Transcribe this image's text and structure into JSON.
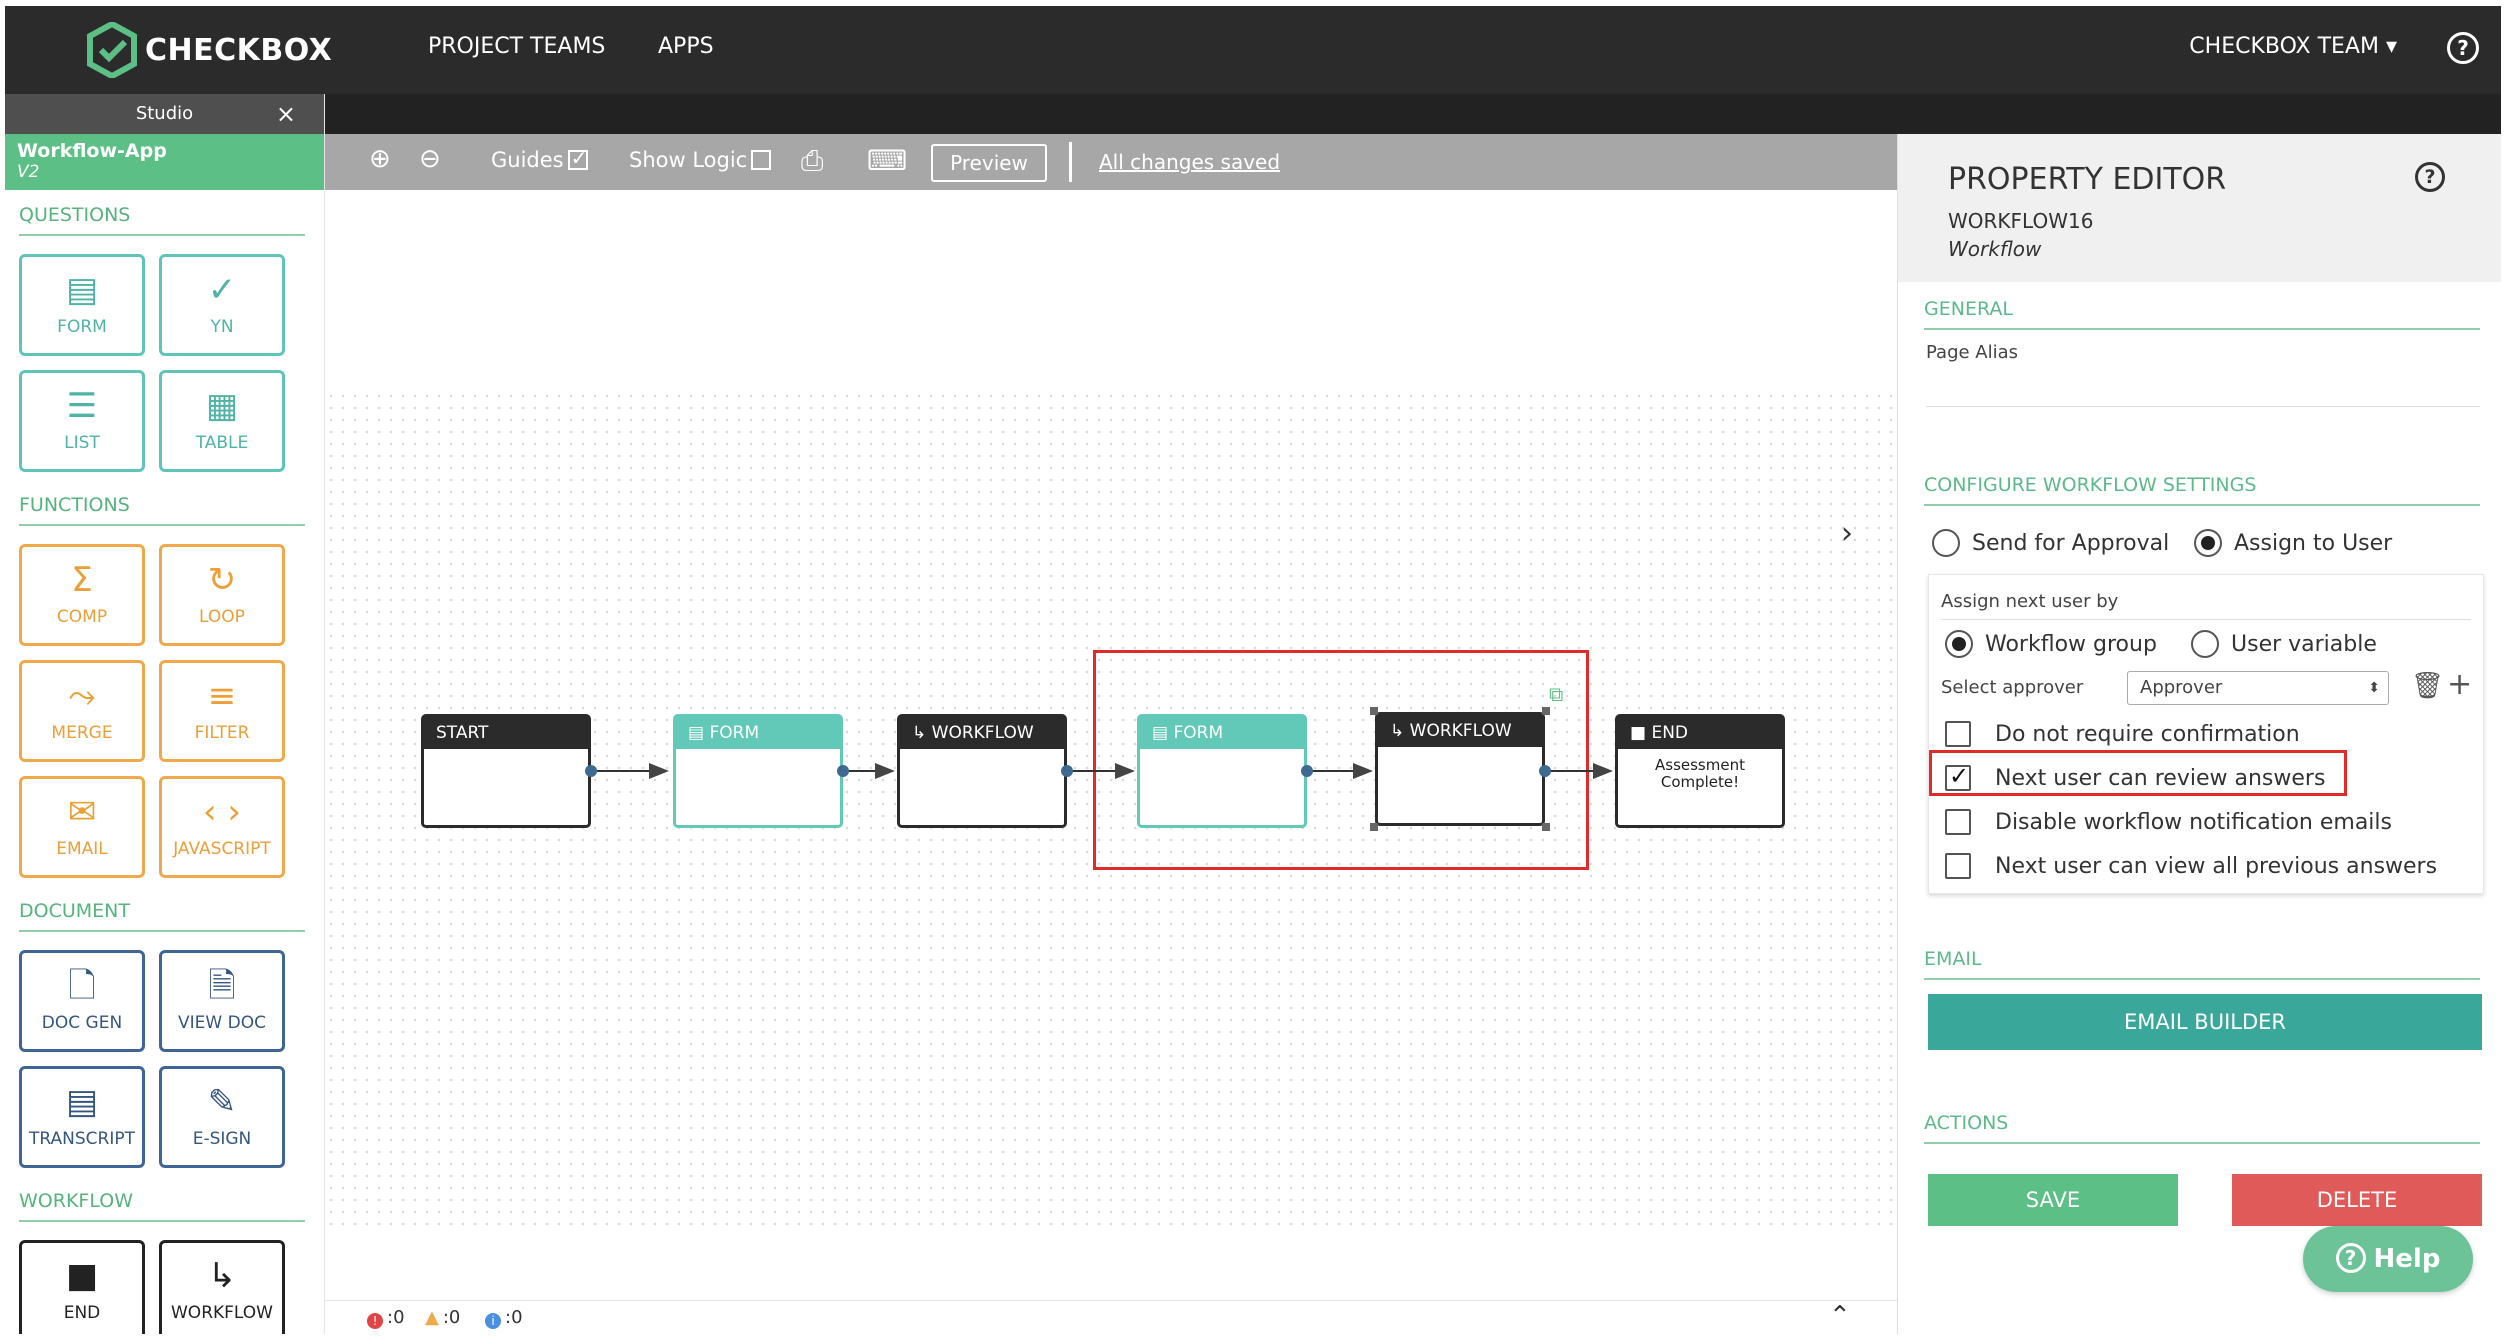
{
  "brand": {
    "name": "CHECKBOX",
    "accent": "#5cbf85"
  },
  "nav": {
    "project_teams": "PROJECT TEAMS",
    "apps": "APPS",
    "team": "CHECKBOX TEAM",
    "help": "?"
  },
  "sidebar": {
    "tab_label": "Studio",
    "close": "×",
    "app_name": "Workflow-App",
    "app_version": "V2",
    "sections": {
      "questions": "QUESTIONS",
      "functions": "FUNCTIONS",
      "document": "DOCUMENT",
      "workflow": "WORKFLOW"
    },
    "questions": [
      "FORM",
      "YN",
      "LIST",
      "TABLE"
    ],
    "functions": [
      "COMP",
      "LOOP",
      "MERGE",
      "FILTER",
      "EMAIL",
      "JAVASCRIPT"
    ],
    "document": [
      "DOC GEN",
      "VIEW DOC",
      "TRANSCRIPT",
      "E-SIGN"
    ],
    "workflow": [
      "END",
      "WORKFLOW"
    ]
  },
  "toolbar": {
    "guides": "Guides",
    "guides_checked": true,
    "show_logic": "Show Logic",
    "show_logic_checked": false,
    "preview": "Preview",
    "saved": "All changes saved"
  },
  "canvas": {
    "nodes": [
      {
        "label": "START",
        "body": ""
      },
      {
        "label": "FORM",
        "body": ""
      },
      {
        "label": "WORKFLOW",
        "body": ""
      },
      {
        "label": "FORM",
        "body": ""
      },
      {
        "label": "WORKFLOW",
        "body": ""
      },
      {
        "label": "END",
        "body": "Assessment Complete!"
      }
    ]
  },
  "status": {
    "errors": ":0",
    "warnings": ":0",
    "info": ":0"
  },
  "property_editor": {
    "title": "PROPERTY EDITOR",
    "element_id": "WORKFLOW16",
    "element_type": "Workflow",
    "general": "GENERAL",
    "page_alias": "Page Alias",
    "configure": "CONFIGURE WORKFLOW SETTINGS",
    "send_for_approval": "Send for Approval",
    "assign_to_user": "Assign to User",
    "assign_next_by": "Assign next user by",
    "workflow_group": "Workflow group",
    "user_variable": "User variable",
    "select_approver": "Select approver",
    "approver_value": "Approver",
    "options": [
      {
        "label": "Do not require confirmation",
        "checked": false
      },
      {
        "label": "Next user can review answers",
        "checked": true
      },
      {
        "label": "Disable workflow notification emails",
        "checked": false
      },
      {
        "label": "Next user can view all previous answers",
        "checked": false
      }
    ],
    "email": "EMAIL",
    "email_builder": "EMAIL BUILDER",
    "actions": "ACTIONS",
    "save": "SAVE",
    "delete": "DELETE",
    "help": "Help"
  }
}
